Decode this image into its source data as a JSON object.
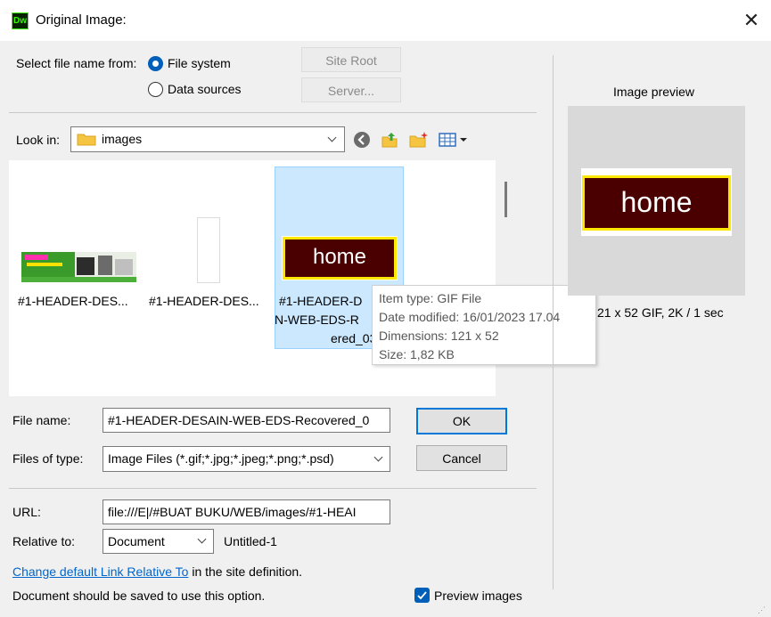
{
  "window": {
    "title": "Original Image:",
    "app_logo": "Dw"
  },
  "select_from": {
    "label": "Select file name from:",
    "options": [
      "File system",
      "Data sources"
    ],
    "selected": "File system",
    "site_root": "Site Root",
    "server": "Server..."
  },
  "look_in": {
    "label": "Look in:",
    "folder": "images"
  },
  "files": [
    {
      "name": "#1-HEADER-DES..."
    },
    {
      "name": "#1-HEADER-DES..."
    },
    {
      "name_lines": [
        "#1-HEADER-D",
        "N-WEB-EDS-R",
        "ered_03.gi"
      ],
      "thumb_text": "home",
      "selected": true
    }
  ],
  "tooltip": {
    "item_type": "Item type: GIF File",
    "date_modified": "Date modified: 16/01/2023 17.04",
    "dimensions": "Dimensions: 121 x 52",
    "size": "Size: 1,82 KB"
  },
  "file_name": {
    "label": "File name:",
    "value": "#1-HEADER-DESAIN-WEB-EDS-Recovered_0"
  },
  "files_of_type": {
    "label": "Files of type:",
    "value": "Image Files (*.gif;*.jpg;*.jpeg;*.png;*.psd)"
  },
  "buttons": {
    "ok": "OK",
    "cancel": "Cancel"
  },
  "url": {
    "label": "URL:",
    "value": "file:///E|/#BUAT BUKU/WEB/images/#1-HEAI"
  },
  "relative_to": {
    "label": "Relative to:",
    "value": "Document",
    "doc_name": "Untitled-1"
  },
  "link_note": {
    "link": "Change default Link Relative To",
    "rest": " in the site definition."
  },
  "save_note": "Document should be saved to use this option.",
  "preview_images": {
    "label": "Preview images",
    "checked": true
  },
  "preview": {
    "label": "Image preview",
    "thumb_text": "home",
    "info": "21 x 52 GIF, 2K / 1 sec"
  },
  "colors": {
    "accent": "#0078d7",
    "selection": "#cce8ff",
    "home_bg": "#4a0000",
    "home_border": "#ffe800"
  }
}
